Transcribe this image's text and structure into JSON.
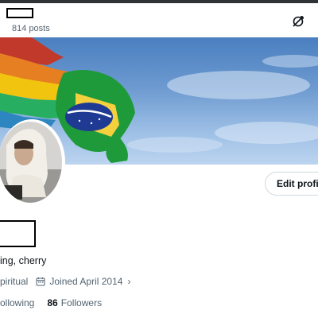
{
  "header": {
    "posts_count": "814 posts",
    "icons": [
      "monetize-icon"
    ]
  },
  "profile": {
    "edit_profile_label": "Edit profi",
    "bio": "ing, cherry",
    "category": "piritual",
    "joined": "Joined April 2014",
    "following_label": "ollowing",
    "followers_count": "86",
    "followers_label": "Followers"
  },
  "colors": {
    "text_primary": "#0f1419",
    "text_secondary": "#536471",
    "border": "#cfd9de"
  }
}
